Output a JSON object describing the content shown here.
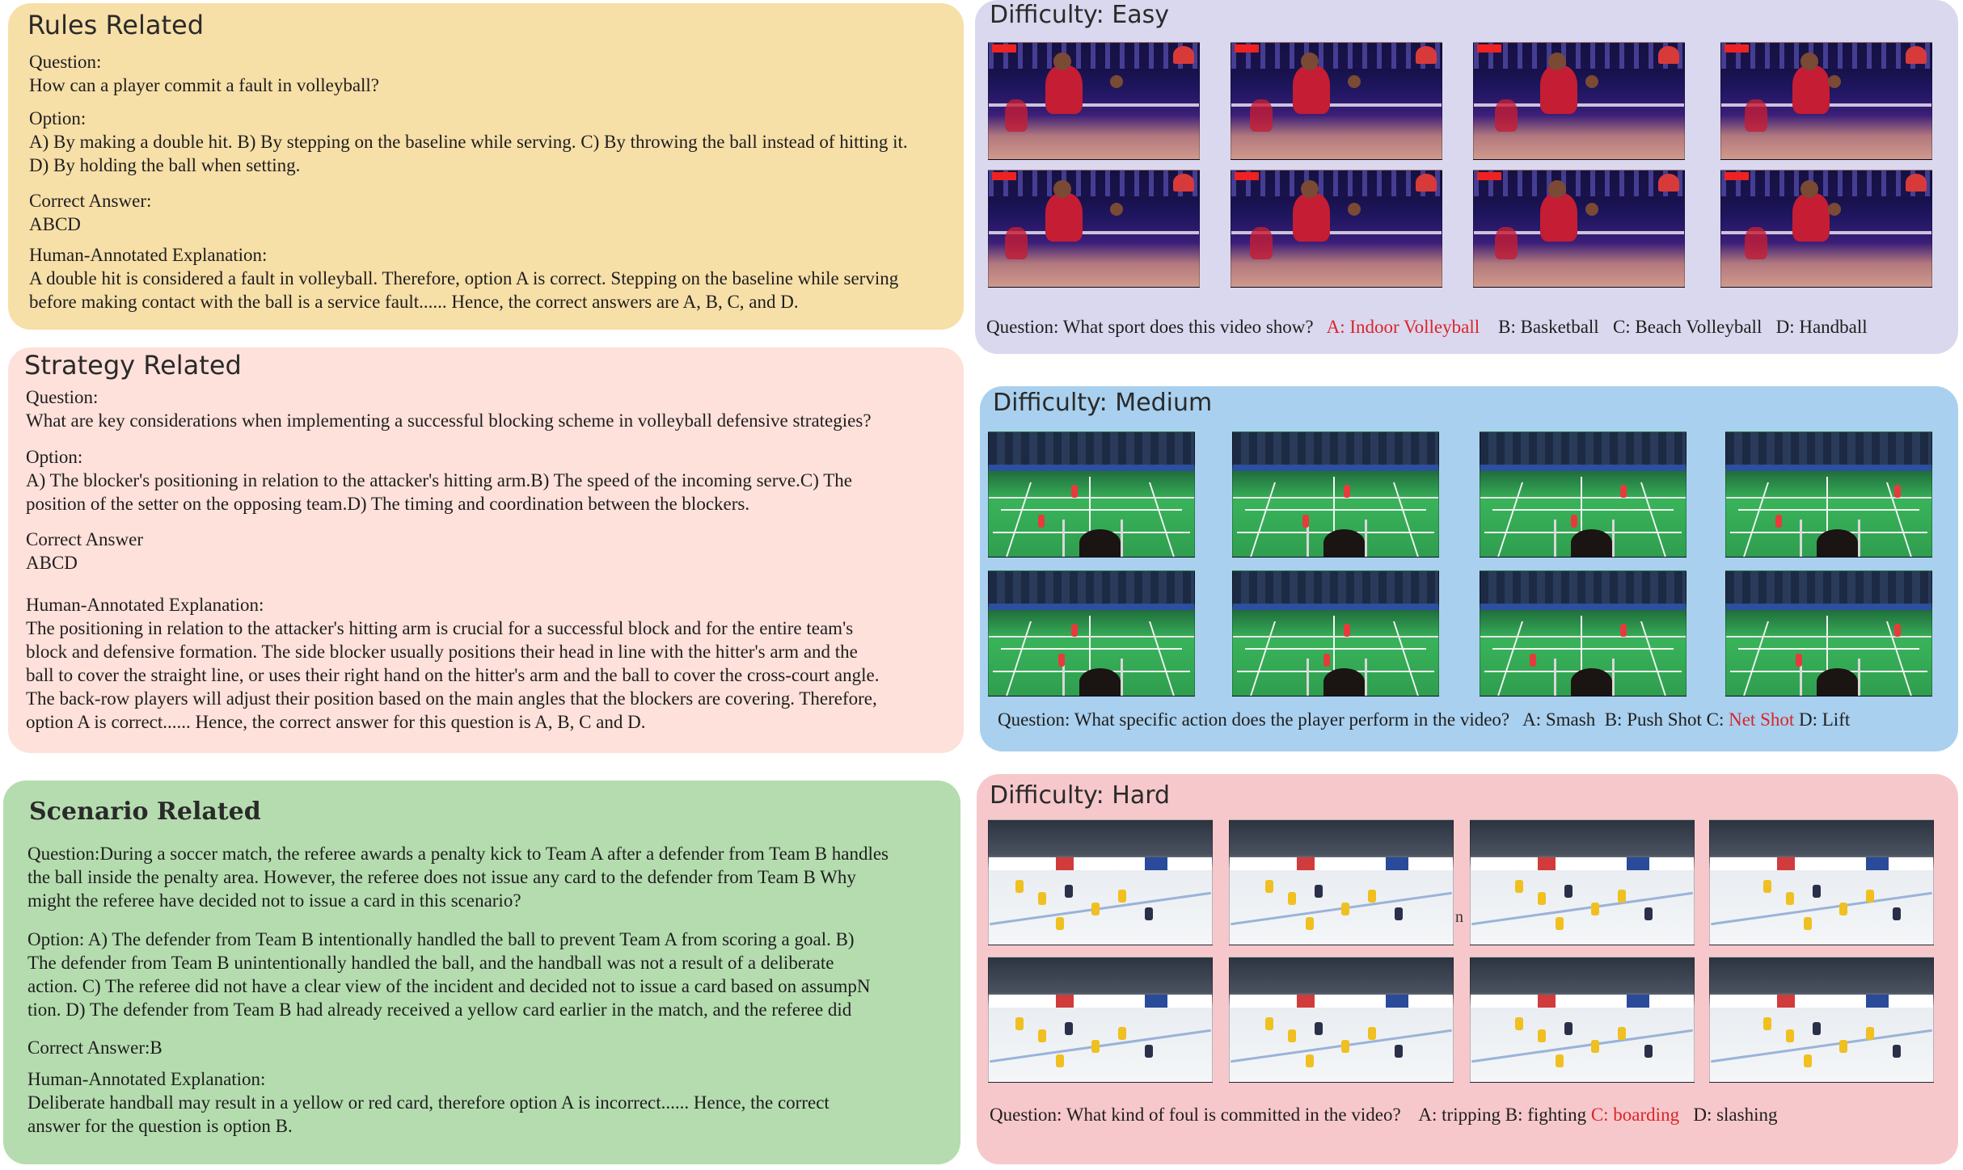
{
  "rules": {
    "title": "Rules Related",
    "question_label": "Question:",
    "question": "How can a player commit a fault in volleyball?",
    "option_label": "Option:",
    "option_line1": "A) By making a double hit. B) By stepping on the baseline while serving. C) By throwing the ball instead of hitting it.",
    "option_line2": "D) By holding the ball when setting.",
    "answer_label": "Correct Answer:",
    "answer": "ABCD",
    "explanation_label": "Human-Annotated Explanation:",
    "explanation_line1": "A double hit is considered a fault in volleyball. Therefore, option A is correct. Stepping on the baseline while serving",
    "explanation_line2": "before making contact with the ball is a service fault...... Hence, the correct answers are A, B, C, and D."
  },
  "strategy": {
    "title": "Strategy Related",
    "question_label": "Question:",
    "question": "What are key considerations when implementing a successful blocking scheme in volleyball defensive strategies?",
    "option_label": "Option:",
    "option_line1": "A) The blocker's positioning in relation to the attacker's hitting arm.B) The speed of the incoming serve.C) The",
    "option_line2": "position of the setter on the opposing team.D) The timing and coordination between the blockers.",
    "answer_label": "Correct Answer",
    "answer": "ABCD",
    "explanation_label": "Human-Annotated Explanation:",
    "explanation_line1": "The positioning in relation to the attacker's hitting arm is crucial for a successful block and for the entire team's",
    "explanation_line2": "block and defensive formation. The side blocker usually positions their head in line with the hitter's arm and the",
    "explanation_line3": "ball to cover the straight line, or uses their right hand on the hitter's arm and the ball to cover the cross-court angle.",
    "explanation_line4": "The back-row players will adjust their position based on the main angles that the blockers are covering. Therefore,",
    "explanation_line5": "option A is correct...... Hence, the correct answer for this question is A, B, C and D."
  },
  "scenario": {
    "title": "Scenario Related",
    "question_line1": "Question:During a soccer match, the referee awards a penalty kick to Team A after a defender from Team B handles",
    "question_line2": "the ball inside the penalty area. However, the referee does not issue any card to the defender from Team B Why",
    "question_line3": "might the referee have decided not to issue a card in this scenario?",
    "option_line1": "Option: A) The defender from Team B intentionally handled the ball to prevent Team A from scoring a goal. B)",
    "option_line2": "The defender from Team B unintentionally handled the ball, and the handball was not a result of a deliberate",
    "option_line3": "action. C) The referee did not have a clear view of the incident and decided not to issue a card based on assumpN",
    "option_line4": "tion. D) The defender from Team B had already received a yellow card earlier in the match, and the referee did",
    "answer": "Correct Answer:B",
    "explanation_label": "Human-Annotated Explanation:",
    "explanation_line1": "Deliberate handball may result in a yellow or red card, therefore option A is incorrect...... Hence, the correct",
    "explanation_line2": "answer for the question is option B."
  },
  "easy": {
    "title": "Difficulty: Easy",
    "question": "Question: What sport does this video show?",
    "opt_a": "A: Indoor Volleyball",
    "opt_b": "B: Basketball",
    "opt_c": "C: Beach Volleyball",
    "opt_d": "D: Handball"
  },
  "medium": {
    "title": "Difficulty: Medium",
    "question": "Question: What specific action does the player perform in the video?",
    "opt_a": "A: Smash",
    "opt_b": "B: Push Shot",
    "opt_c_prefix": "C:",
    "opt_c": "Net Shot",
    "opt_d": "D: Lift"
  },
  "hard": {
    "title": "Difficulty: Hard",
    "question": "Question: What kind of foul is committed in the video?",
    "opt_a": "A: tripping",
    "opt_b": "B: fighting",
    "opt_c": "C: boarding",
    "opt_d": "D: slashing",
    "stray_char": "n"
  },
  "colors": {
    "rules_bg": "#f7dfa8",
    "strategy_bg": "#fde1da",
    "scenario_bg": "#b5dcaf",
    "easy_bg": "#dad8ee",
    "medium_bg": "#a9d0ee",
    "hard_bg": "#f7c8cb",
    "answer_highlight": "#d9252a"
  }
}
